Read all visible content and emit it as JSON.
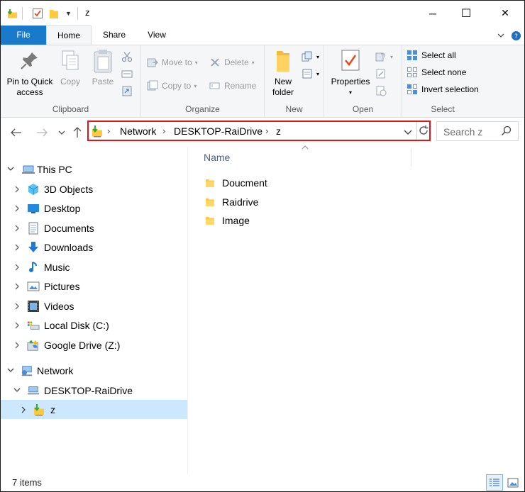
{
  "window": {
    "title": "z",
    "controls": {
      "minimize": "─",
      "maximize": "☐",
      "close": "✕"
    }
  },
  "ribbon_tabs": [
    {
      "label": "File"
    },
    {
      "label": "Home"
    },
    {
      "label": "Share"
    },
    {
      "label": "View"
    }
  ],
  "ribbon": {
    "clipboard": {
      "group_label": "Clipboard",
      "pin_label_1": "Pin to Quick",
      "pin_label_2": "access",
      "copy_label": "Copy",
      "paste_label": "Paste"
    },
    "organize": {
      "group_label": "Organize",
      "move_to": "Move to",
      "copy_to": "Copy to",
      "delete": "Delete",
      "rename": "Rename"
    },
    "new": {
      "group_label": "New",
      "new_folder_1": "New",
      "new_folder_2": "folder"
    },
    "open": {
      "group_label": "Open",
      "properties": "Properties"
    },
    "select": {
      "group_label": "Select",
      "select_all": "Select all",
      "select_none": "Select none",
      "invert_selection": "Invert selection"
    }
  },
  "address_bar": {
    "crumbs": [
      "Network",
      "DESKTOP-RaiDrive",
      "z"
    ],
    "search_placeholder": "Search z"
  },
  "nav_pane": {
    "this_pc": "This PC",
    "this_pc_items": [
      {
        "label": "3D Objects",
        "icon": "3d-objects-icon"
      },
      {
        "label": "Desktop",
        "icon": "desktop-icon"
      },
      {
        "label": "Documents",
        "icon": "documents-icon"
      },
      {
        "label": "Downloads",
        "icon": "downloads-icon"
      },
      {
        "label": "Music",
        "icon": "music-icon"
      },
      {
        "label": "Pictures",
        "icon": "pictures-icon"
      },
      {
        "label": "Videos",
        "icon": "videos-icon"
      },
      {
        "label": "Local Disk (C:)",
        "icon": "local-disk-icon"
      },
      {
        "label": "Google Drive (Z:)",
        "icon": "google-drive-icon"
      }
    ],
    "network": "Network",
    "network_host": "DESKTOP-RaiDrive",
    "network_share": "z"
  },
  "content": {
    "column_name": "Name",
    "items": [
      {
        "name": "Doucment",
        "icon": "folder-icon"
      },
      {
        "name": "Raidrive",
        "icon": "folder-icon"
      },
      {
        "name": "Image",
        "icon": "folder-icon"
      }
    ]
  },
  "status": {
    "item_count": "7 items"
  },
  "colors": {
    "accent": "#1979ca",
    "selection": "#cce8ff",
    "highlight_border": "#e0161b",
    "folder": "#ffc83d"
  }
}
